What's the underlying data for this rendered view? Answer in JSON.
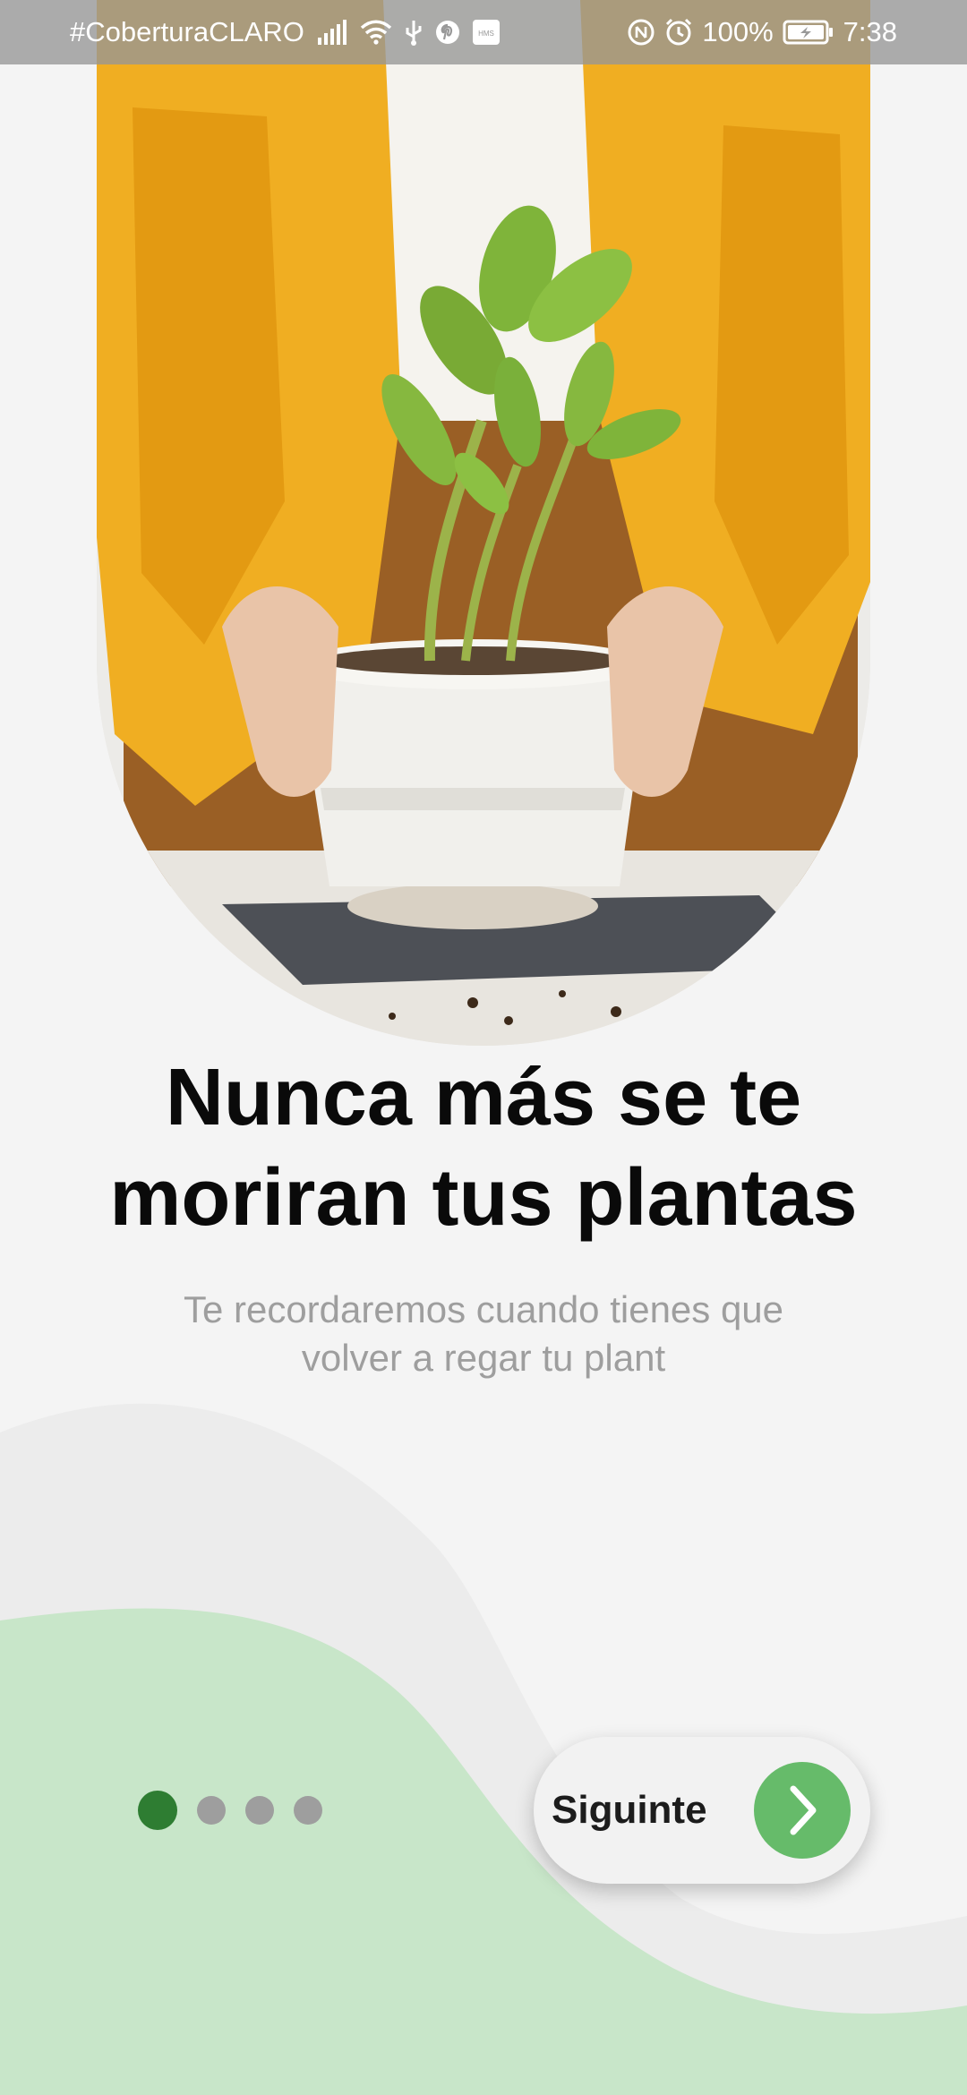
{
  "status_bar": {
    "carrier": "#CoberturaCLARO",
    "battery": "100%",
    "time": "7:38",
    "icons_left": [
      "signal-icon",
      "wifi-icon",
      "usb-icon",
      "pinterest-icon",
      "hms-icon"
    ],
    "icons_right": [
      "nfc-icon",
      "alarm-icon",
      "battery-icon"
    ],
    "hms_label": "HMS"
  },
  "onboarding": {
    "title_line1": "Nunca más se te",
    "title_line2": "moriran tus plantas",
    "subtitle_line1": "Te recordaremos cuando tienes que",
    "subtitle_line2": "volver a regar tu plant",
    "page_count": 4,
    "current_page": 1,
    "next_label": "Siguinte"
  },
  "colors": {
    "background": "#f4f4f4",
    "wave_light": "#ececec",
    "wave_green": "#c8e6c9",
    "dot_active": "#2e7d32",
    "dot_inactive": "#9e9e9e",
    "next_circle": "#66bb6a",
    "title": "#0a0a0a",
    "subtitle": "#9e9e9e"
  }
}
